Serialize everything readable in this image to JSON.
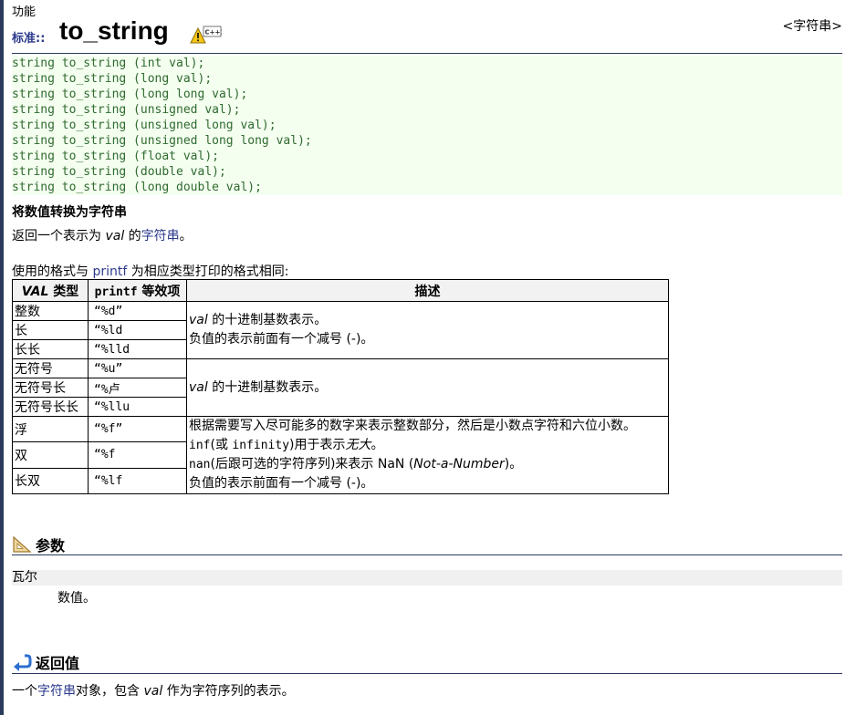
{
  "header": {
    "section_kind": "功能",
    "namespace": "标准::",
    "function_name": "to_string",
    "badge_text": "C++11",
    "return_type_link": "<字符串>"
  },
  "prototypes": [
    "string to_string (int val);",
    "string to_string (long val);",
    "string to_string (long long val);",
    "string to_string (unsigned val);",
    "string to_string (unsigned long val);",
    "string to_string (unsigned long long val);",
    "string to_string (float val);",
    "string to_string (double val);",
    "string to_string (long double val);"
  ],
  "summary": {
    "heading": "将数值转换为字符串",
    "line_prefix": "返回一个表示为",
    "line_val": "val",
    "line_mid": "的",
    "line_link": "字符串",
    "line_end": "。",
    "format_prefix": "使用的格式与",
    "format_link": "printf",
    "format_suffix": "为相应类型打印的格式相同:"
  },
  "table": {
    "headers": {
      "type_val": "VAL",
      "type_rest": "类型",
      "printf": "printf",
      "printf_rest": "等效项",
      "desc": "描述"
    },
    "rows": [
      {
        "type": "整数",
        "fmt": "“%d”"
      },
      {
        "type": "长",
        "fmt": "“%ld"
      },
      {
        "type": "长长",
        "fmt": "“%lld"
      },
      {
        "type": "无符号",
        "fmt": "“%u”"
      },
      {
        "type": "无符号长",
        "fmt": "“%卢"
      },
      {
        "type": "无符号长长",
        "fmt": "“%llu"
      },
      {
        "type": "浮",
        "fmt": "“%f”"
      },
      {
        "type": "双",
        "fmt": "“%f"
      },
      {
        "type": "长双",
        "fmt": "“%lf"
      }
    ],
    "desc_signed_val": "val",
    "desc_signed_1": "的十进制基数表示。",
    "desc_signed_2": "负值的表示前面有一个减号 (-)。",
    "desc_unsigned_val": "val",
    "desc_unsigned_1": "的十进制基数表示。",
    "desc_float_1": "根据需要写入尽可能多的数字来表示整数部分，然后是小数点字符和六位小数。",
    "desc_float_2_code": "inf",
    "desc_float_2_mid": "(或",
    "desc_float_2_code2": "infinity",
    "desc_float_2_end": ")用于表示",
    "desc_float_2_ital": "无大",
    "desc_float_2_dot": "。",
    "desc_float_3_code": "nan",
    "desc_float_3_mid": "(后跟可选的字符序列)来表示 NaN (",
    "desc_float_3_ital": "Not-a-Number",
    "desc_float_3_end": ")。",
    "desc_float_4": "负值的表示前面有一个减号 (-)。"
  },
  "params": {
    "title": "参数",
    "name": "瓦尔",
    "desc": "数值。"
  },
  "return_value": {
    "title": "返回值",
    "prefix": "一个",
    "link": "字符串",
    "mid": "对象，包含",
    "val": "val",
    "suffix": "作为字符序列的表示。"
  },
  "colors": {
    "proto_bg": "#f4fff0",
    "proto_text": "#2f6a2f",
    "link": "#2b3a8c",
    "rule": "#2b3a5c"
  },
  "icons": [
    "warning-icon",
    "ruler-triangle-icon",
    "return-arrow-icon"
  ]
}
